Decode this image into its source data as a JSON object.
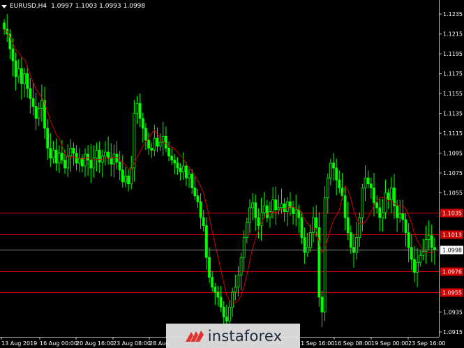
{
  "header": {
    "symbol": "EURUSD,H4",
    "open": "1.0997",
    "high": "1.1003",
    "low": "1.0993",
    "close": "1.0998"
  },
  "colors": {
    "background": "#000000",
    "bull": "#00ff00",
    "bear": "#00ff00",
    "ma": "#d40000",
    "level": "#d40000",
    "price_tag": "#ffffff",
    "axis_text": "#ffffff",
    "axis_line": "#c0c0c0"
  },
  "watermark": {
    "text": "instaforex",
    "icon": "instaforex-logo-icon"
  },
  "chart_data": {
    "type": "candlestick",
    "y_range": [
      1.091,
      1.1245
    ],
    "y_ticks": [
      "1.1235",
      "1.1215",
      "1.1195",
      "1.1175",
      "1.1155",
      "1.1135",
      "1.1115",
      "1.1095",
      "1.1075",
      "1.1055",
      "1.0935",
      "1.0915"
    ],
    "x_ticks": [
      "13 Aug 2019",
      "16 Aug 00:00",
      "20 Aug 16:00",
      "23 Aug 08:00",
      "28 Aug",
      "11 Sep 16:00",
      "16 Sep 08:00",
      "19 Sep 00:00",
      "23 Sep 16:00"
    ],
    "current_price": "1.0998",
    "levels": [
      {
        "label": "1.1035",
        "value": 1.1035
      },
      {
        "label": "1.1013",
        "value": 1.1013
      },
      {
        "label": "1.0976",
        "value": 1.0976
      },
      {
        "label": "1.0955",
        "value": 1.0955
      }
    ],
    "ma_period_note": "",
    "closes": [
      1.122,
      1.1215,
      1.12,
      1.1188,
      1.1172,
      1.118,
      1.1165,
      1.1175,
      1.116,
      1.115,
      1.1142,
      1.113,
      1.114,
      1.1148,
      1.112,
      1.11,
      1.109,
      1.1098,
      1.1085,
      1.1095,
      1.1088,
      1.108,
      1.1092,
      1.11,
      1.1095,
      1.1085,
      1.109,
      1.1082,
      1.1094,
      1.1088,
      1.108,
      1.109,
      1.1098,
      1.1086,
      1.1092,
      1.1096,
      1.109,
      1.1084,
      1.1094,
      1.1086,
      1.1078,
      1.1066,
      1.1072,
      1.1064,
      1.108,
      1.1135,
      1.1145,
      1.113,
      1.112,
      1.1108,
      1.11,
      1.1098,
      1.111,
      1.1102,
      1.1106,
      1.1112,
      1.11,
      1.1092,
      1.1088,
      1.1085,
      1.108,
      1.1076,
      1.1082,
      1.107,
      1.1074,
      1.106,
      1.1052,
      1.1046,
      1.103,
      1.1022,
      1.099,
      1.097,
      1.096,
      1.0955,
      1.095,
      1.094,
      1.093,
      1.0926,
      1.094,
      1.0955,
      1.096,
      1.0972,
      1.099,
      1.101,
      1.1025,
      1.104,
      1.1045,
      1.103,
      1.1022,
      1.1035,
      1.1042,
      1.103,
      1.1036,
      1.1048,
      1.1038,
      1.104,
      1.1044,
      1.1036,
      1.1046,
      1.104,
      1.1034,
      1.1038,
      1.103,
      1.101,
      1.0995,
      1.1,
      1.1015,
      1.103,
      1.102,
      1.095,
      1.0935,
      1.105,
      1.107,
      1.1085,
      1.108,
      1.1068,
      1.106,
      1.1052,
      1.103,
      1.1015,
      1.1,
      1.0995,
      1.101,
      1.103,
      1.106,
      1.107,
      1.1064,
      1.106,
      1.1045,
      1.104,
      1.103,
      1.1035,
      1.1055,
      1.1048,
      1.106,
      1.1042,
      1.103,
      1.1034,
      1.1028,
      1.1015,
      1.1,
      1.0988,
      1.0975,
      1.0985,
      1.0992,
      1.0996,
      1.1008,
      1.1012,
      1.1,
      1.0998
    ]
  }
}
